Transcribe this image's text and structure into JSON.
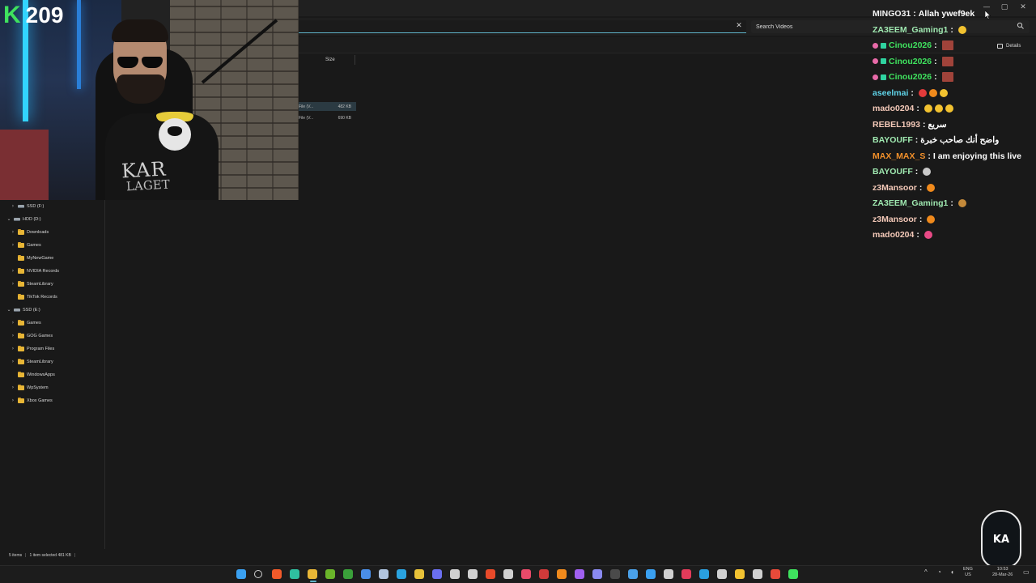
{
  "explorer": {
    "search_placeholder": "Search Videos",
    "details_label": "Details",
    "column_size": "Size",
    "files": [
      {
        "type": "File (V...",
        "size": "482 KB",
        "selected": true
      },
      {
        "type": "File (V...",
        "size": "690 KB",
        "selected": false
      }
    ],
    "status": {
      "items": "5 items",
      "sep": "|",
      "selected": "1 item selected  481 KB",
      "sep2": "|"
    },
    "tree": [
      {
        "label": "SSD (F:)",
        "kind": "drive",
        "indent": 1,
        "chevron": ">"
      },
      {
        "label": "HDD (D:)",
        "kind": "drive",
        "indent": 0,
        "chevron": "v"
      },
      {
        "label": "Downloads",
        "kind": "folder",
        "indent": 1,
        "chevron": ">"
      },
      {
        "label": "Games",
        "kind": "folder",
        "indent": 1,
        "chevron": ">"
      },
      {
        "label": "MyNewGame",
        "kind": "folder",
        "indent": 1,
        "chevron": ""
      },
      {
        "label": "NVIDIA Records",
        "kind": "folder",
        "indent": 1,
        "chevron": ">"
      },
      {
        "label": "SteamLibrary",
        "kind": "folder",
        "indent": 1,
        "chevron": ">"
      },
      {
        "label": "TikTok Records",
        "kind": "folder",
        "indent": 1,
        "chevron": ""
      },
      {
        "label": "SSD (E:)",
        "kind": "drive",
        "indent": 0,
        "chevron": "v"
      },
      {
        "label": "Games",
        "kind": "folder",
        "indent": 1,
        "chevron": ">"
      },
      {
        "label": "GOG Games",
        "kind": "folder",
        "indent": 1,
        "chevron": ">"
      },
      {
        "label": "Program Files",
        "kind": "folder",
        "indent": 1,
        "chevron": ">"
      },
      {
        "label": "SteamLibrary",
        "kind": "folder",
        "indent": 1,
        "chevron": ">"
      },
      {
        "label": "WindowsApps",
        "kind": "folder",
        "indent": 1,
        "chevron": ""
      },
      {
        "label": "WpSystem",
        "kind": "folder",
        "indent": 1,
        "chevron": ">"
      },
      {
        "label": "Xbox Games",
        "kind": "folder",
        "indent": 1,
        "chevron": ">"
      }
    ]
  },
  "webcam": {
    "follower_count": "209",
    "shirt_text_1": "KAR",
    "shirt_text_2": "LAGET"
  },
  "chat": [
    {
      "name": "MINGO31",
      "color": "#f2f2f2",
      "msg": "Allah ywef9ek",
      "badges": [],
      "emotes": []
    },
    {
      "name": "ZA3EEM_Gaming1",
      "color": "#9fe8b0",
      "msg": "",
      "badges": [],
      "emotes": [
        "#f2c230"
      ]
    },
    {
      "name": "Cinou2026",
      "color": "#3fe15e",
      "msg": "",
      "badges": [
        "pink-circle",
        "green-square"
      ],
      "emotes": [
        "emote-sq"
      ]
    },
    {
      "name": "Cinou2026",
      "color": "#3fe15e",
      "msg": "",
      "badges": [
        "pink-circle",
        "green-square"
      ],
      "emotes": [
        "emote-sq"
      ]
    },
    {
      "name": "Cinou2026",
      "color": "#3fe15e",
      "msg": "",
      "badges": [
        "pink-circle",
        "green-square"
      ],
      "emotes": [
        "emote-sq"
      ]
    },
    {
      "name": "aseelmai",
      "color": "#5fd3e8",
      "msg": "",
      "badges": [],
      "emotes": [
        "#e23b3b",
        "#f08a1c",
        "#f2c230"
      ]
    },
    {
      "name": "mado0204",
      "color": "#f4c9b8",
      "msg": "",
      "badges": [],
      "emotes": [
        "#f2c230",
        "#f2c230",
        "#f2c230"
      ]
    },
    {
      "name": "REBEL1993",
      "color": "#f4c9b8",
      "msg": "سريع",
      "badges": [],
      "emotes": []
    },
    {
      "name": "BAYOUFF",
      "color": "#9fe8b0",
      "msg": "واضح أنك صاحب خبرة",
      "badges": [],
      "emotes": []
    },
    {
      "name": "MAX_MAX_S",
      "color": "#f2902a",
      "msg": "I am enjoying this live",
      "badges": [],
      "emotes": []
    },
    {
      "name": "BAYOUFF",
      "color": "#9fe8b0",
      "msg": "",
      "badges": [],
      "emotes": [
        "#c9c9c9"
      ]
    },
    {
      "name": "z3Mansoor",
      "color": "#f4c9b8",
      "msg": "",
      "badges": [],
      "emotes": [
        "#f08a1c"
      ]
    },
    {
      "name": "ZA3EEM_Gaming1",
      "color": "#9fe8b0",
      "msg": "",
      "badges": [],
      "emotes": [
        "#c48a3a"
      ]
    },
    {
      "name": "z3Mansoor",
      "color": "#f4c9b8",
      "msg": "",
      "badges": [],
      "emotes": [
        "#f08a1c"
      ]
    },
    {
      "name": "mado0204",
      "color": "#f4c9b8",
      "msg": "",
      "badges": [],
      "emotes": [
        "#e84a86"
      ]
    }
  ],
  "logo": {
    "text": "KA"
  },
  "taskbar": {
    "icons": [
      {
        "name": "start-icon",
        "color": "#3aa0f0"
      },
      {
        "name": "search-taskbar-icon",
        "color": "#d0d0d0"
      },
      {
        "name": "brave-icon",
        "color": "#f25a2a"
      },
      {
        "name": "edge-icon",
        "color": "#2fbfa0"
      },
      {
        "name": "file-explorer-icon",
        "color": "#e8b636"
      },
      {
        "name": "nvidia-icon",
        "color": "#6ab42a"
      },
      {
        "name": "xbox-icon",
        "color": "#3aa03a"
      },
      {
        "name": "globe-icon",
        "color": "#4a8ee8"
      },
      {
        "name": "steam-icon",
        "color": "#b0c4de"
      },
      {
        "name": "telegram-icon",
        "color": "#2aa3e0"
      },
      {
        "name": "folder-app-icon",
        "color": "#e8c23a"
      },
      {
        "name": "discord-icon",
        "color": "#6b6ff0"
      },
      {
        "name": "chrome-icon",
        "color": "#d0d0d0"
      },
      {
        "name": "obs-icon",
        "color": "#d0d0d0"
      },
      {
        "name": "capcut-icon",
        "color": "#e84a2a"
      },
      {
        "name": "chatgpt-icon",
        "color": "#d0d0d0"
      },
      {
        "name": "tiktok-icon",
        "color": "#e84a6a"
      },
      {
        "name": "record-icon",
        "color": "#d03a3a"
      },
      {
        "name": "cloud-icon",
        "color": "#f08a1c"
      },
      {
        "name": "wallpaper-icon",
        "color": "#a060f0"
      },
      {
        "name": "app-icon",
        "color": "#8a8af0"
      },
      {
        "name": "lg-icon",
        "color": "#4a4a4a"
      },
      {
        "name": "settings-app-icon",
        "color": "#4aa0e8"
      },
      {
        "name": "ka-app-icon",
        "color": "#3aa0f0"
      },
      {
        "name": "grid-icon",
        "color": "#d0d0d0"
      },
      {
        "name": "red-app-icon",
        "color": "#e23b5a"
      },
      {
        "name": "blue-app-icon",
        "color": "#2aa0e0"
      },
      {
        "name": "pen-icon",
        "color": "#d0d0d0"
      },
      {
        "name": "yellow-app-icon",
        "color": "#f2c230"
      },
      {
        "name": "link-icon",
        "color": "#d0d0d0"
      },
      {
        "name": "chrome-dev-icon",
        "color": "#e84a3a"
      },
      {
        "name": "green-app-icon",
        "color": "#3fe15e"
      }
    ],
    "lang": "ENG",
    "region": "US",
    "time": "10:53",
    "date": "28-Mar-26"
  }
}
